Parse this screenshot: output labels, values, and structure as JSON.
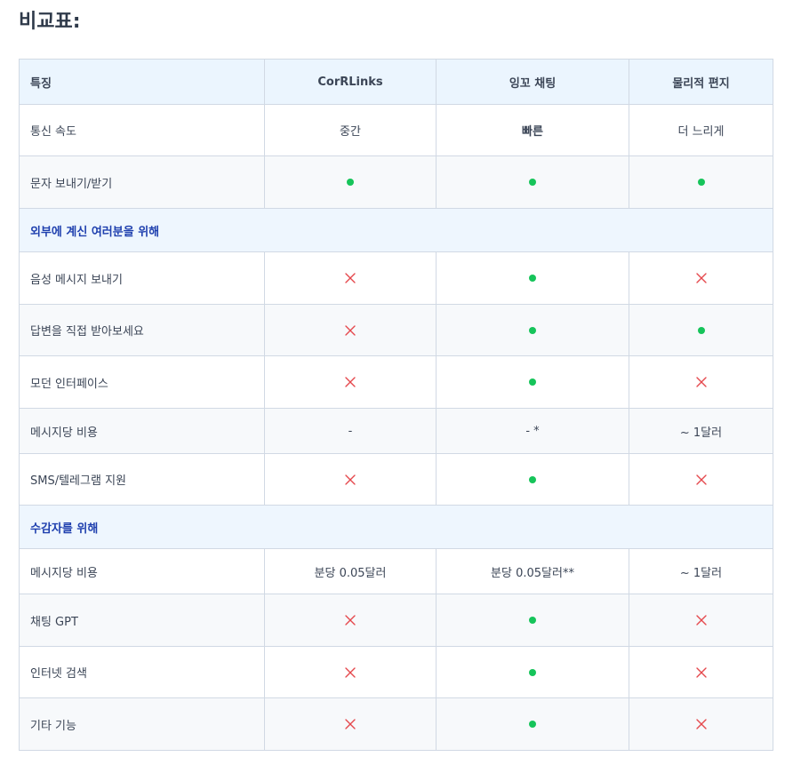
{
  "page": {
    "heading": "비교표:"
  },
  "colors": {
    "orange": "#d68a10",
    "blue": "#2f86e6",
    "yes": "#16c45a",
    "no": "#e5484d",
    "section": "#1e3fae"
  },
  "table": {
    "headers": [
      "특징",
      "CorRLinks",
      "잉꼬 채팅",
      "물리적 편지"
    ],
    "rows": [
      {
        "type": "data",
        "label": "통신 속도",
        "cells": [
          {
            "kind": "text",
            "value": "중간"
          },
          {
            "kind": "text",
            "value": "빠른"
          },
          {
            "kind": "text",
            "value": "더 느리게"
          }
        ]
      },
      {
        "type": "data",
        "label": "문자 보내기/받기",
        "cells": [
          {
            "kind": "yes"
          },
          {
            "kind": "yes"
          },
          {
            "kind": "yes"
          }
        ]
      },
      {
        "type": "section",
        "label": "외부에 계신 여러분을 위해"
      },
      {
        "type": "data",
        "label": "음성 메시지 보내기",
        "cells": [
          {
            "kind": "no"
          },
          {
            "kind": "yes"
          },
          {
            "kind": "no"
          }
        ]
      },
      {
        "type": "data",
        "label": "답변을 직접 받아보세요",
        "cells": [
          {
            "kind": "no"
          },
          {
            "kind": "yes"
          },
          {
            "kind": "yes"
          }
        ]
      },
      {
        "type": "data",
        "label": "모던 인터페이스",
        "cells": [
          {
            "kind": "no"
          },
          {
            "kind": "yes"
          },
          {
            "kind": "no"
          }
        ]
      },
      {
        "type": "data",
        "label": "메시지당 비용",
        "cells": [
          {
            "kind": "text",
            "value": "-"
          },
          {
            "kind": "text",
            "value": "- *"
          },
          {
            "kind": "text",
            "value": "~ 1달러"
          }
        ]
      },
      {
        "type": "data",
        "label": "SMS/텔레그램 지원",
        "cells": [
          {
            "kind": "no"
          },
          {
            "kind": "yes"
          },
          {
            "kind": "no"
          }
        ]
      },
      {
        "type": "section",
        "label": "수감자를 위해"
      },
      {
        "type": "data",
        "label": "메시지당 비용",
        "cells": [
          {
            "kind": "text",
            "value": "분당 0.05달러"
          },
          {
            "kind": "text",
            "value": "분당 0.05달러**"
          },
          {
            "kind": "text",
            "value": "~ 1달러"
          }
        ]
      },
      {
        "type": "data",
        "label": "채팅 GPT",
        "cells": [
          {
            "kind": "no"
          },
          {
            "kind": "yes"
          },
          {
            "kind": "no"
          }
        ]
      },
      {
        "type": "data",
        "label": "인터넷 검색",
        "cells": [
          {
            "kind": "no"
          },
          {
            "kind": "yes"
          },
          {
            "kind": "no"
          }
        ]
      },
      {
        "type": "data",
        "label": "기타 기능",
        "cells": [
          {
            "kind": "no"
          },
          {
            "kind": "yes"
          },
          {
            "kind": "no"
          }
        ]
      }
    ]
  }
}
